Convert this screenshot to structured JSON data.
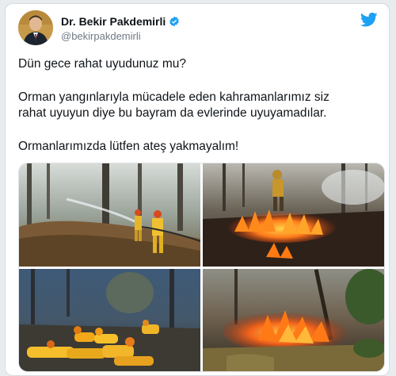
{
  "tweet": {
    "author": {
      "display_name": "Dr. Bekir Pakdemirli",
      "handle": "@bekirpakdemirli",
      "avatar_icon": "profile-photo",
      "verified_icon": "verified-badge-icon"
    },
    "platform_icon": "twitter-bird-icon",
    "paragraphs": [
      "Dün gece rahat uyudunuz mu?",
      "Orman yangınlarıyla mücadele eden kahramanlarımız siz",
      "rahat uyuyun diye bu bayram da evlerinde uyuyamadılar.",
      "Ormanlarımızda lütfen ateş yakmayalım!"
    ],
    "media": [
      {
        "name": "firefighters-hose-forest-photo"
      },
      {
        "name": "burning-ground-firefighter-photo"
      },
      {
        "name": "resting-firefighters-photo"
      },
      {
        "name": "forest-fire-flames-photo"
      }
    ]
  },
  "colors": {
    "twitter_blue": "#1da1f2",
    "text": "#0f1419",
    "secondary_text": "#6e7a85"
  }
}
